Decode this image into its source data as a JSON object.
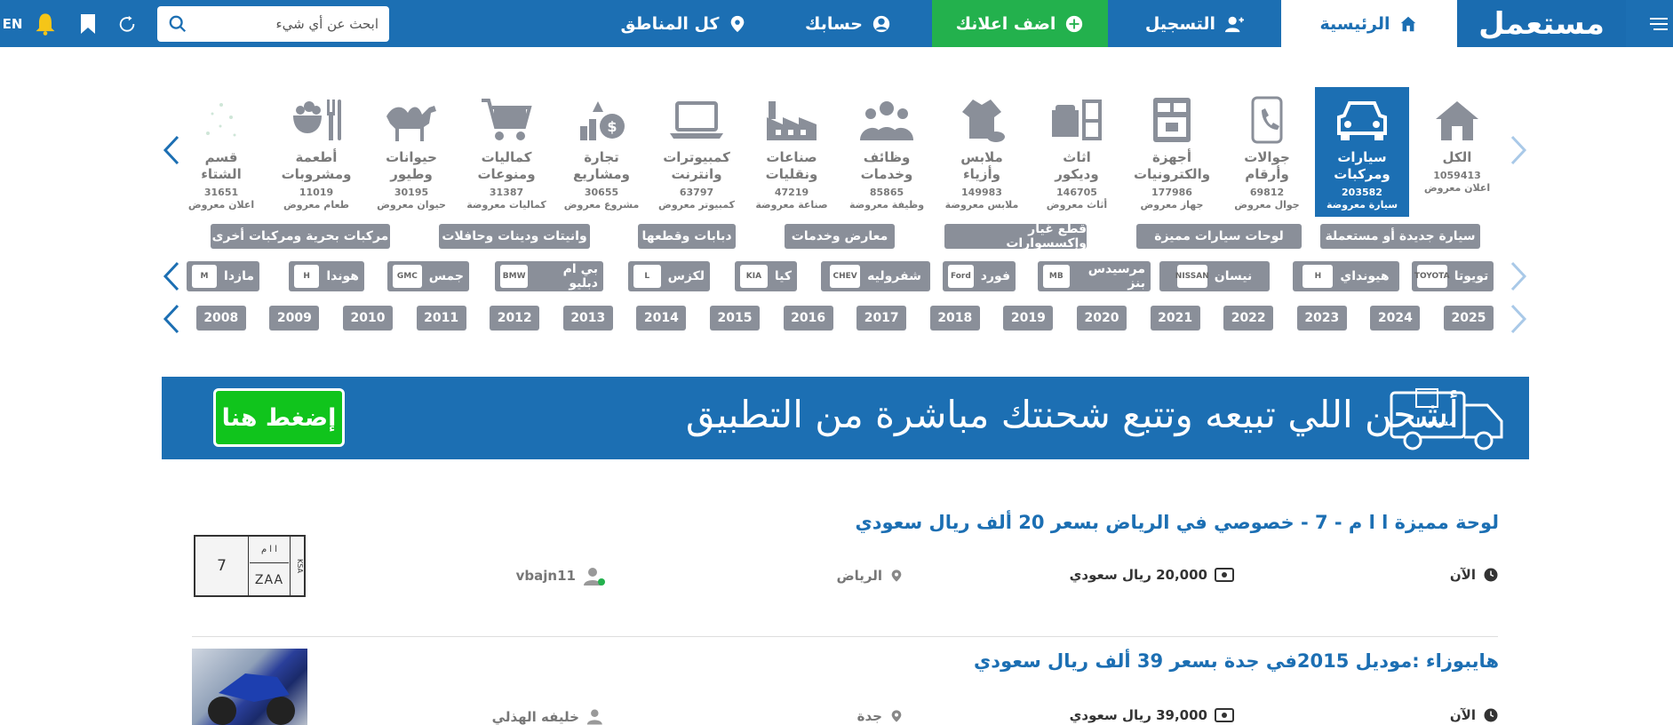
{
  "nav": {
    "logo": "مستعمل",
    "home": "الرئيسية",
    "register": "التسجيل",
    "add_ad": "اضف اعلانك",
    "account": "حسابك",
    "regions": "كل المناطق",
    "search_placeholder": "ابحث عن أي شيء",
    "lang": "EN"
  },
  "categories": [
    {
      "label1": "الكل",
      "label2": "",
      "count": "1059413",
      "sub": "اعلان معروض",
      "icon": "house-icon"
    },
    {
      "label1": "سيارات",
      "label2": "ومركبات",
      "count": "203582",
      "sub": "سيارة معروضة",
      "icon": "car-icon"
    },
    {
      "label1": "جوالات",
      "label2": "وأرقام",
      "count": "69812",
      "sub": "جوال معروض",
      "icon": "phone-icon"
    },
    {
      "label1": "أجهزة",
      "label2": "والكترونيات",
      "count": "177986",
      "sub": "جهاز معروض",
      "icon": "appliance-icon"
    },
    {
      "label1": "اثاث",
      "label2": "وديكور",
      "count": "146705",
      "sub": "أثاث معروض",
      "icon": "furniture-icon"
    },
    {
      "label1": "ملابس",
      "label2": "وأزياء",
      "count": "149983",
      "sub": "ملابس معروضة",
      "icon": "clothes-icon"
    },
    {
      "label1": "وظائف",
      "label2": "وخدمات",
      "count": "85865",
      "sub": "وظيفة معروضة",
      "icon": "people-icon"
    },
    {
      "label1": "صناعات",
      "label2": "ونقليات",
      "count": "47219",
      "sub": "صناعة معروضة",
      "icon": "factory-icon"
    },
    {
      "label1": "كمبيوترات",
      "label2": "وانترنت",
      "count": "63797",
      "sub": "كمبيوتر معروض",
      "icon": "laptop-icon"
    },
    {
      "label1": "تجارة",
      "label2": "ومشاريع",
      "count": "30655",
      "sub": "مشروع معروض",
      "icon": "money-growth-icon"
    },
    {
      "label1": "كماليات",
      "label2": "ومنوعات",
      "count": "31387",
      "sub": "كماليات معروضة",
      "icon": "cart-icon"
    },
    {
      "label1": "حيوانات",
      "label2": "وطيور",
      "count": "30195",
      "sub": "حيوان معروض",
      "icon": "camel-icon"
    },
    {
      "label1": "أطعمة",
      "label2": "ومشروبات",
      "count": "11019",
      "sub": "طعام معروض",
      "icon": "food-icon"
    },
    {
      "label1": "قسم",
      "label2": "الشتاء",
      "count": "31651",
      "sub": "اعلان معروض",
      "icon": "snow-icon"
    }
  ],
  "chips": [
    "سيارة جديدة أو مستعملة",
    "لوحات سيارات مميزة",
    "قطع غيار وإكسسوارات",
    "معارض وخدمات",
    "دبابات وقطعها",
    "وانيتات ودينات وحافلات",
    "مركبات بحرية ومركبات أخرى"
  ],
  "brands": [
    {
      "name": "تويوتا",
      "logo": "TOYOTA"
    },
    {
      "name": "هيونداي",
      "logo": "H"
    },
    {
      "name": "نيسان",
      "logo": "NISSAN"
    },
    {
      "name": "مرسيدس بنز",
      "logo": "MB"
    },
    {
      "name": "فورد",
      "logo": "Ford"
    },
    {
      "name": "شفروليه",
      "logo": "CHEV"
    },
    {
      "name": "كيا",
      "logo": "KIA"
    },
    {
      "name": "لكزس",
      "logo": "L"
    },
    {
      "name": "بي ام دبليو",
      "logo": "BMW"
    },
    {
      "name": "جمس",
      "logo": "GMC"
    },
    {
      "name": "هوندا",
      "logo": "H"
    },
    {
      "name": "مازدا",
      "logo": "M"
    }
  ],
  "years": [
    "2025",
    "2024",
    "2023",
    "2022",
    "2021",
    "2020",
    "2019",
    "2018",
    "2017",
    "2016",
    "2015",
    "2014",
    "2013",
    "2012",
    "2011",
    "2010",
    "2009",
    "2008"
  ],
  "banner": {
    "text": "أشحن اللي تبيعه وتتبع شحنتك مباشرة من التطبيق",
    "button": "إضغط هنا",
    "truck_label": "مستعمل"
  },
  "listings": [
    {
      "title": "لوحة مميزة ا ا م - 7 - خصوصي في الرياض بسعر 20 ألف ريال سعودي",
      "time": "الآن",
      "price": "20,000 ريال سعودي",
      "city": "الرياض",
      "user": "vbajn11",
      "plate": {
        "number": "7",
        "letters": "ZAA",
        "ar_letters": "ا ا م",
        "ksa": "KSA"
      }
    },
    {
      "title": "هايبوزاء :موديل 2015في جدة بسعر 39 ألف ريال سعودي",
      "time": "الآن",
      "price": "39,000 ريال سعودي",
      "city": "جدة",
      "user": "خليفه الهذلي"
    }
  ],
  "colors": {
    "primary": "#1c6fb3",
    "green": "#23b14d",
    "chip": "#8a8f99",
    "banner_button": "#10c41c"
  }
}
